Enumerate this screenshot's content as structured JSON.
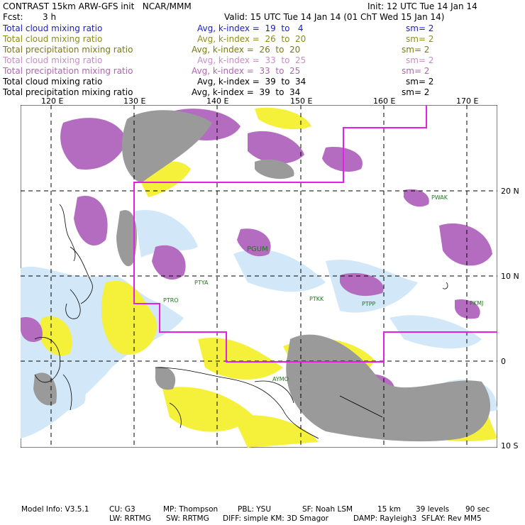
{
  "header": {
    "title": "CONTRAST 15km ARW-GFS init   NCAR/MMM",
    "init": "Init: 12 UTC Tue 14 Jan 14",
    "fcst_label": "Fcst:",
    "fcst_value": "3 h",
    "valid": "Valid: 15 UTC Tue 14 Jan 14 (01 ChT Wed 15 Jan 14)"
  },
  "legend": [
    {
      "name": "Total cloud mixing ratio",
      "range": "Avg, k-index =  19  to   4",
      "sm": "sm= 2",
      "color": "#1a1acc"
    },
    {
      "name": "Total cloud mixing ratio",
      "range": "Avg, k-index =  26  to  20",
      "sm": "sm= 2",
      "color": "#8c8c1a"
    },
    {
      "name": "Total precipitation mixing ratio",
      "range": "Avg, k-index =  26  to  20",
      "sm": "sm= 2",
      "color": "#7a7a14"
    },
    {
      "name": "Total cloud mixing ratio",
      "range": "Avg, k-index =  33  to  25",
      "sm": "sm= 2",
      "color": "#c48ec4"
    },
    {
      "name": "Total precipitation mixing ratio",
      "range": "Avg, k-index =  33  to  25",
      "sm": "sm= 2",
      "color": "#b066b0"
    },
    {
      "name": "Total cloud mixing ratio",
      "range": "Avg, k-index =  39  to  34",
      "sm": "sm= 2",
      "color": "#000000"
    },
    {
      "name": "Total precipitation mixing ratio",
      "range": "Avg, k-index =  39  to  34",
      "sm": "sm= 2",
      "color": "#000000"
    }
  ],
  "map": {
    "lon_ticks": [
      "120 E",
      "130 E",
      "140 E",
      "150 E",
      "160 E",
      "170 E"
    ],
    "lat_ticks": [
      "20 N",
      "10 N",
      "0",
      "10 S"
    ],
    "stations": [
      "PWAK",
      "PGUM",
      "PTYA",
      "PTRO",
      "PTKK",
      "PTPP",
      "PKMJ",
      "AYMO"
    ],
    "colors": {
      "cloud_low": "#cfe6f7",
      "cloud_mid": "#f5f03a",
      "cloud_high": "#b46cc0",
      "grey": "#9a9a9a",
      "boundary": "#e61ee6"
    }
  },
  "footer": {
    "model_info": "Model Info: V3.5.1",
    "cu": "CU: G3",
    "mp": "MP: Thompson",
    "pbl": "PBL: YSU",
    "sf": "SF: Noah LSM",
    "res": "15 km",
    "levels": "39 levels",
    "dt": "90 sec",
    "lw": "LW: RRTMG",
    "sw": "SW: RRTMG",
    "diff": "DIFF: simple KM: 3D Smagor",
    "damp": "DAMP: Rayleigh3",
    "sflay": "SFLAY: Rev MM5"
  }
}
